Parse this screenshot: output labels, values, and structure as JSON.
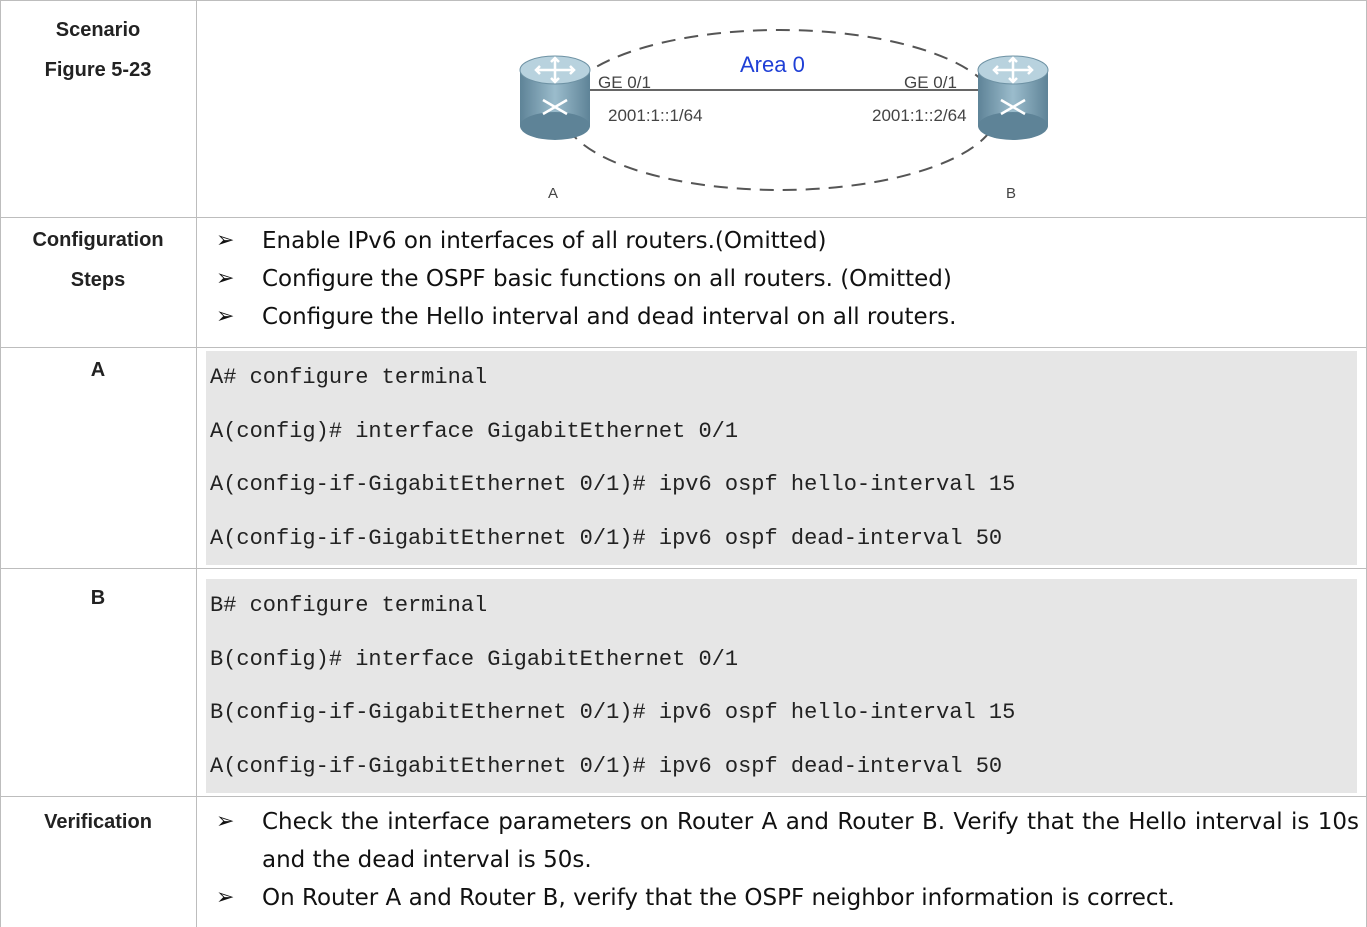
{
  "rows": {
    "scenario": {
      "label1": "Scenario",
      "label2": "Figure 5-23"
    },
    "steps": {
      "label1": "Configuration",
      "label2": "Steps",
      "items": [
        "Enable IPv6 on interfaces of all routers.(Omitted)",
        "Configure the OSPF basic functions on all routers. (Omitted)",
        "Configure the Hello interval and dead interval on all routers."
      ]
    },
    "a": {
      "label": "A",
      "lines": [
        "A# configure terminal",
        "A(config)# interface GigabitEthernet 0/1",
        "A(config-if-GigabitEthernet 0/1)# ipv6 ospf hello-interval 15",
        "A(config-if-GigabitEthernet 0/1)# ipv6 ospf dead-interval 50"
      ]
    },
    "b": {
      "label": "B",
      "lines": [
        "B# configure terminal",
        "B(config)# interface GigabitEthernet 0/1",
        "B(config-if-GigabitEthernet 0/1)# ipv6 ospf hello-interval 15",
        "A(config-if-GigabitEthernet 0/1)# ipv6 ospf dead-interval 50"
      ]
    },
    "verification": {
      "label": "Verification",
      "items": [
        "Check the interface parameters on Router A and Router B. Verify that the Hello interval is 10s and the dead interval is 50s.",
        "On Router A and Router B, verify that the OSPF neighbor information is correct."
      ]
    }
  },
  "diagram": {
    "area": "Area 0",
    "router_a": {
      "name": "A",
      "port": "GE 0/1",
      "ip": "2001:1::1/64"
    },
    "router_b": {
      "name": "B",
      "port": "GE 0/1",
      "ip": "2001:1::2/64"
    },
    "colors": {
      "area": "#1f3fd6",
      "router": "#7fa3b8"
    }
  },
  "bullet_symbol": "➢"
}
